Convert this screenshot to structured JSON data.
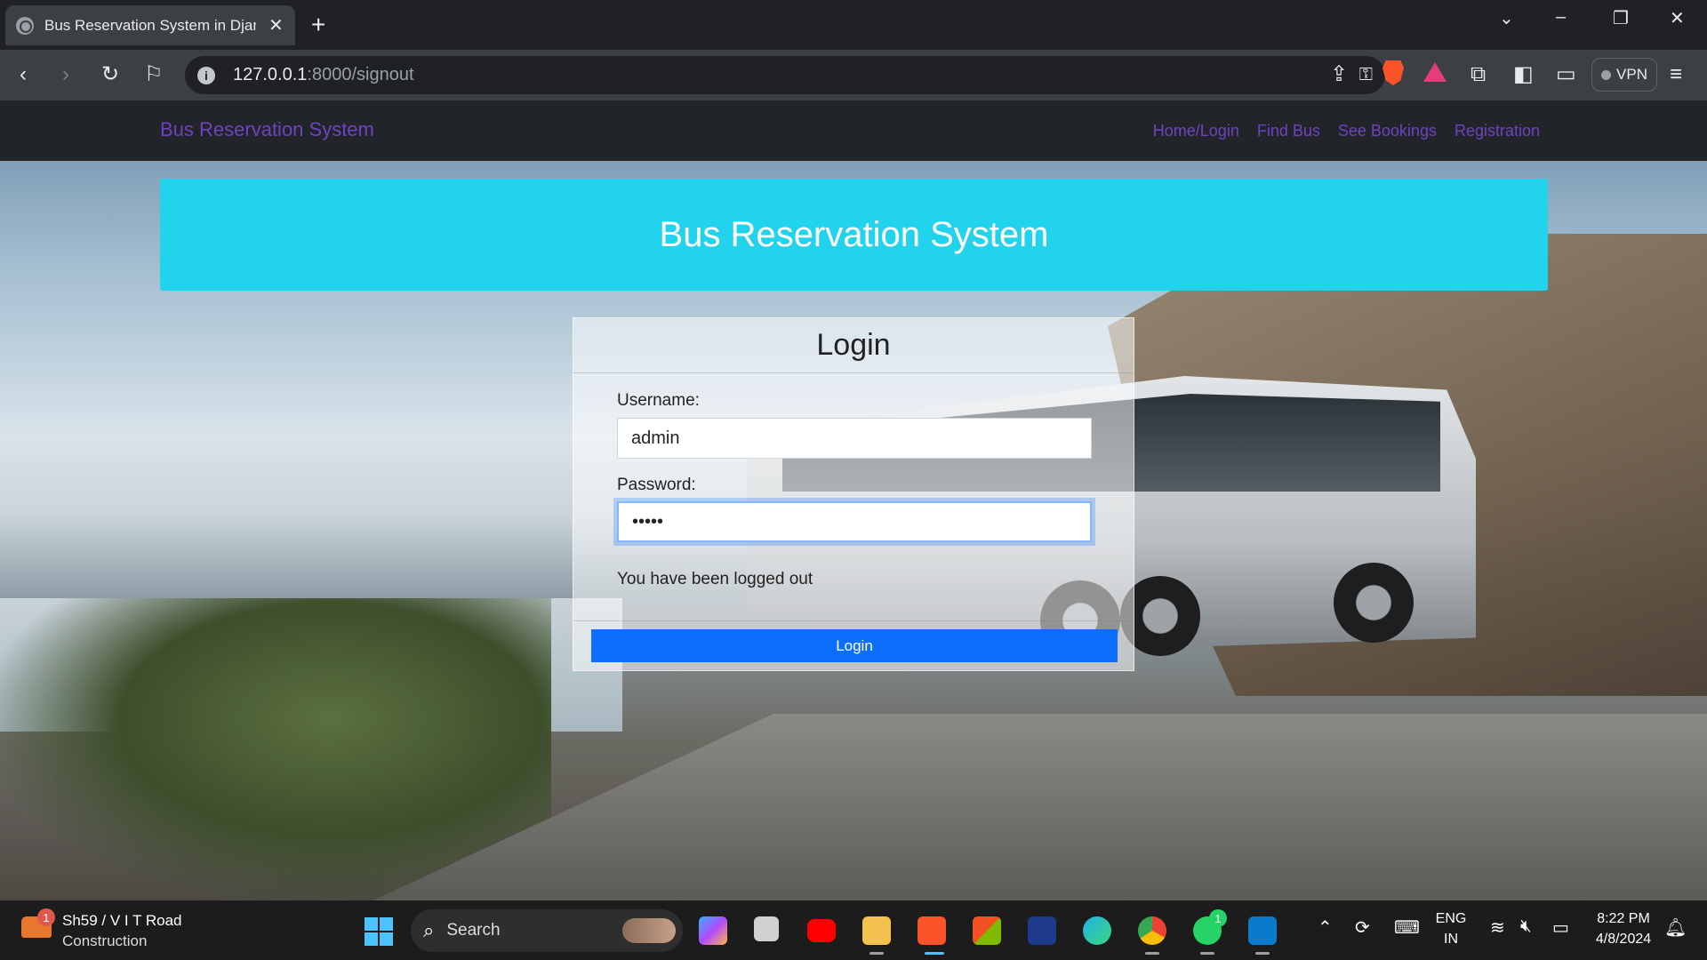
{
  "browser": {
    "tab_title": "Bus Reservation System in Djang",
    "tab_close": "✕",
    "new_tab": "+",
    "url_host": "127.0.0.1",
    "url_rest": ":8000/signout",
    "vpn_label": "VPN"
  },
  "navbar": {
    "brand": "Bus Reservation System",
    "links": [
      "Home/Login",
      "Find Bus",
      "See Bookings",
      "Registration"
    ]
  },
  "hero": {
    "title": "Bus Reservation System"
  },
  "login": {
    "title": "Login",
    "username_label": "Username:",
    "username_value": "admin",
    "password_label": "Password:",
    "password_value": "•••••",
    "message": "You have been logged out",
    "button_label": "Login"
  },
  "taskbar": {
    "weather_badge": "1",
    "weather_line1": "Sh59 / V I T Road",
    "weather_line2": "Construction",
    "search_label": "Search",
    "whatsapp_badge": "1",
    "language_line1": "ENG",
    "language_line2": "IN",
    "time": "8:22 PM",
    "date": "4/8/2024"
  },
  "colors": {
    "hero": "#22d3ee",
    "nav_link": "#6f42c1",
    "login_button": "#0d6efd"
  }
}
